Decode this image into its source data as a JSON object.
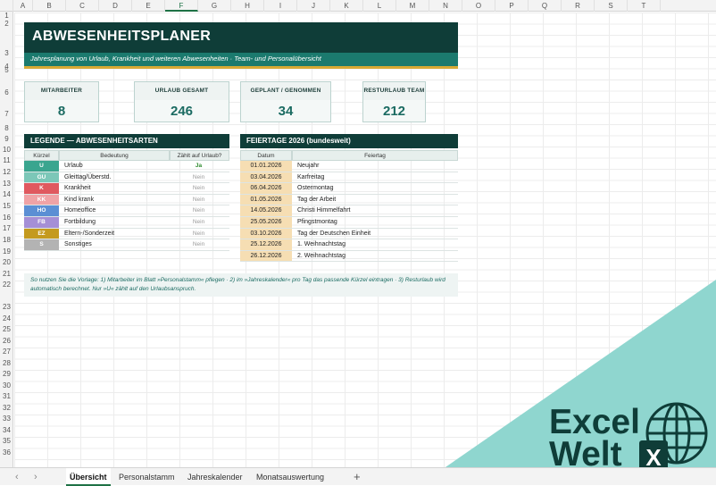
{
  "columns": [
    "A",
    "B",
    "C",
    "D",
    "E",
    "F",
    "G",
    "H",
    "I",
    "J",
    "K",
    "L",
    "M",
    "N",
    "O",
    "P",
    "Q",
    "R",
    "S",
    "T"
  ],
  "rows": [
    "1",
    "2",
    "3",
    "4",
    "5",
    "6",
    "7",
    "8",
    "9",
    "10",
    "11",
    "12",
    "13",
    "14",
    "15",
    "16",
    "17",
    "18",
    "19",
    "20",
    "21",
    "22",
    "23",
    "24",
    "25",
    "26",
    "27",
    "28",
    "29",
    "30",
    "31",
    "32",
    "33",
    "34",
    "35",
    "36"
  ],
  "header": {
    "title": "ABWESENHEITSPLANER",
    "subtitle": "Jahresplanung von Urlaub, Krankheit und weiteren Abwesenheiten · Team- und Personalübersicht"
  },
  "kpis": [
    {
      "label": "MITARBEITER",
      "value": "8"
    },
    {
      "label": "URLAUB GESAMT",
      "value": "246"
    },
    {
      "label": "GEPLANT / GENOMMEN",
      "value": "34"
    },
    {
      "label": "RESTURLAUB TEAM",
      "value": "212"
    }
  ],
  "legend": {
    "title": "LEGENDE — ABWESENHEITSARTEN",
    "col_kuerzel": "Kürzel",
    "col_bedeutung": "Bedeutung",
    "col_zaehlt": "Zählt auf Urlaub?",
    "items": [
      {
        "code": "U",
        "label": "Urlaub",
        "counts": "Ja",
        "color": "#3aa58f"
      },
      {
        "code": "GU",
        "label": "Gleittag/Überstd.",
        "counts": "Nein",
        "color": "#7cc7b8"
      },
      {
        "code": "K",
        "label": "Krankheit",
        "counts": "Nein",
        "color": "#e0595f"
      },
      {
        "code": "KK",
        "label": "Kind krank",
        "counts": "Nein",
        "color": "#f0a3a6"
      },
      {
        "code": "HO",
        "label": "Homeoffice",
        "counts": "Nein",
        "color": "#5b8fd4"
      },
      {
        "code": "FB",
        "label": "Fortbildung",
        "counts": "Nein",
        "color": "#a58fd6"
      },
      {
        "code": "EZ",
        "label": "Eltern-/Sonderzeit",
        "counts": "Nein",
        "color": "#c49a1e"
      },
      {
        "code": "S",
        "label": "Sonstiges",
        "counts": "Nein",
        "color": "#b3b3b3"
      }
    ]
  },
  "holidays": {
    "title": "FEIERTAGE 2026 (bundesweit)",
    "col_datum": "Datum",
    "col_feiertag": "Feiertag",
    "items": [
      {
        "date": "01.01.2026",
        "name": "Neujahr"
      },
      {
        "date": "03.04.2026",
        "name": "Karfreitag"
      },
      {
        "date": "06.04.2026",
        "name": "Ostermontag"
      },
      {
        "date": "01.05.2026",
        "name": "Tag der Arbeit"
      },
      {
        "date": "14.05.2026",
        "name": "Christi Himmelfahrt"
      },
      {
        "date": "25.05.2026",
        "name": "Pfingstmontag"
      },
      {
        "date": "03.10.2026",
        "name": "Tag der Deutschen Einheit"
      },
      {
        "date": "25.12.2026",
        "name": "1. Weihnachtstag"
      },
      {
        "date": "26.12.2026",
        "name": "2. Weihnachtstag"
      }
    ]
  },
  "note": "So nutzen Sie die Vorlage:  1) Mitarbeiter im Blatt »Personalstamm« pflegen  ·  2) im »Jahreskalender« pro Tag das passende Kürzel eintragen  ·  3) Resturlaub wird automatisch berechnet. Nur »U« zählt auf den Urlaubsanspruch.",
  "watermark": {
    "line1": "Excel",
    "line2": "Welt",
    "icon": "globe-excel-icon"
  },
  "tabs": [
    "Übersicht",
    "Personalstamm",
    "Jahreskalender",
    "Monatsauswertung"
  ],
  "active_tab": "Übersicht",
  "add_tab": "+",
  "nav": {
    "prev": "‹",
    "next": "›"
  },
  "colors": {
    "dark_teal": "#0f3d38",
    "teal": "#1b7a6e",
    "gold": "#d7a935",
    "watermark": "#8fd6cf"
  }
}
